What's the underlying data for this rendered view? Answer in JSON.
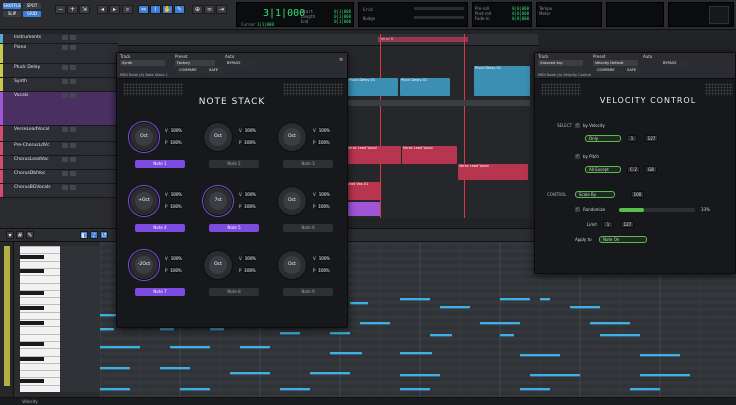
{
  "transport": {
    "counter_main": "3|1|000",
    "counter_sub_labels": [
      "Start",
      "Length",
      "End"
    ],
    "counter_sub_values": [
      "0|1|000",
      "0|1|000",
      "0|1|000"
    ],
    "cursor_label": "Cursor",
    "cursor_value": "1|1|000",
    "nudge_label": "Nudge",
    "grid_label": "Grid",
    "pre_roll_label": "Pre-roll",
    "post_roll_label": "Post-roll",
    "fade_in_label": "Fade-in",
    "tempo_label": "Tempo",
    "meter_label": "Meter",
    "mode_shuffle": "SHUFFLE",
    "mode_spot": "SPOT",
    "mode_slip": "SLIP",
    "mode_grid": "GRID"
  },
  "tracks": [
    {
      "name": "Instruments",
      "color": "#5aa9d6"
    },
    {
      "name": "Piano",
      "color": "#c9c94a"
    },
    {
      "name": "Pluck Delay",
      "color": "#c9c94a"
    },
    {
      "name": "Synth",
      "color": "#c9c94a"
    },
    {
      "name": "Vocals",
      "color": "#a055d6"
    },
    {
      "name": "VerseLeadVocal",
      "color": "#d64a6a"
    },
    {
      "name": "Pre-ChorusLdVc",
      "color": "#d64a6a"
    },
    {
      "name": "ChorusLeadVoc",
      "color": "#d64a6a"
    },
    {
      "name": "ChorusDblVoc",
      "color": "#d64a6a"
    },
    {
      "name": "ChorusBGVocals",
      "color": "#d64a6a"
    }
  ],
  "clips": [
    {
      "label": "Verse B"
    },
    {
      "label": "Pluck Delay-01"
    },
    {
      "label": "Pluck Delay-01"
    },
    {
      "label": "Pluck Delay-01"
    },
    {
      "label": "Verse Lead Vocal"
    },
    {
      "label": "Verse Lead Vocal"
    },
    {
      "label": "Verse Lead Vocal"
    },
    {
      "label": "Lead Voc-01"
    }
  ],
  "note_stack": {
    "track_label": "Track",
    "preset_label": "Preset",
    "auto_label": "Auto",
    "track_value": "Synth",
    "preset_value": "Factory",
    "compare": "COMPARE",
    "safe": "SAFE",
    "bypass": "BYPASS",
    "insert_name": "MIDI Node (A) Note Stack 1",
    "title": "NOTE STACK",
    "cells": [
      {
        "knob": "Oct",
        "btn": "Note 1",
        "on": true
      },
      {
        "knob": "Oct",
        "btn": "Note 2",
        "on": false
      },
      {
        "knob": "Oct",
        "btn": "Note 3",
        "on": false
      },
      {
        "knob": "+Oct",
        "btn": "Note 4",
        "on": true
      },
      {
        "knob": "7st",
        "btn": "Note 5",
        "on": true
      },
      {
        "knob": "Oct",
        "btn": "Note 6",
        "on": false
      },
      {
        "knob": "-2Oct",
        "btn": "Note 7",
        "on": true
      },
      {
        "knob": "Oct",
        "btn": "Note 8",
        "on": false
      },
      {
        "knob": "Oct",
        "btn": "Note 9",
        "on": false
      }
    ],
    "v_label": "V",
    "p_label": "P",
    "v_value": "100%",
    "p_value": "100%"
  },
  "velocity": {
    "track_label": "Track",
    "preset_label": "Preset",
    "auto_label": "Auto",
    "track_value": "Grooved Arp",
    "preset_value": "Velocity Default",
    "compare": "COMPARE",
    "safe": "SAFE",
    "bypass": "BYPASS",
    "insert_name": "MIDI Node (A) Velocity Control",
    "title": "VELOCITY CONTROL",
    "select_label": "SELECT",
    "by_velocity": "by Velocity",
    "only": "Only",
    "v_low": "1",
    "v_high": "127",
    "by_pitch": "by Pitch",
    "all_except": "All Except",
    "p_low": "C-2",
    "p_high": "G8",
    "control_label": "CONTROL",
    "scale_by": "Scale By",
    "scale_val": "100",
    "randomize": "Randomize",
    "rand_val": "33%",
    "limit_label": "Limit",
    "limit_low": "1",
    "limit_high": "127",
    "apply_label": "Apply to",
    "apply_val": "Note On"
  },
  "midi_editor": {
    "velocity_label": "Velocity"
  }
}
